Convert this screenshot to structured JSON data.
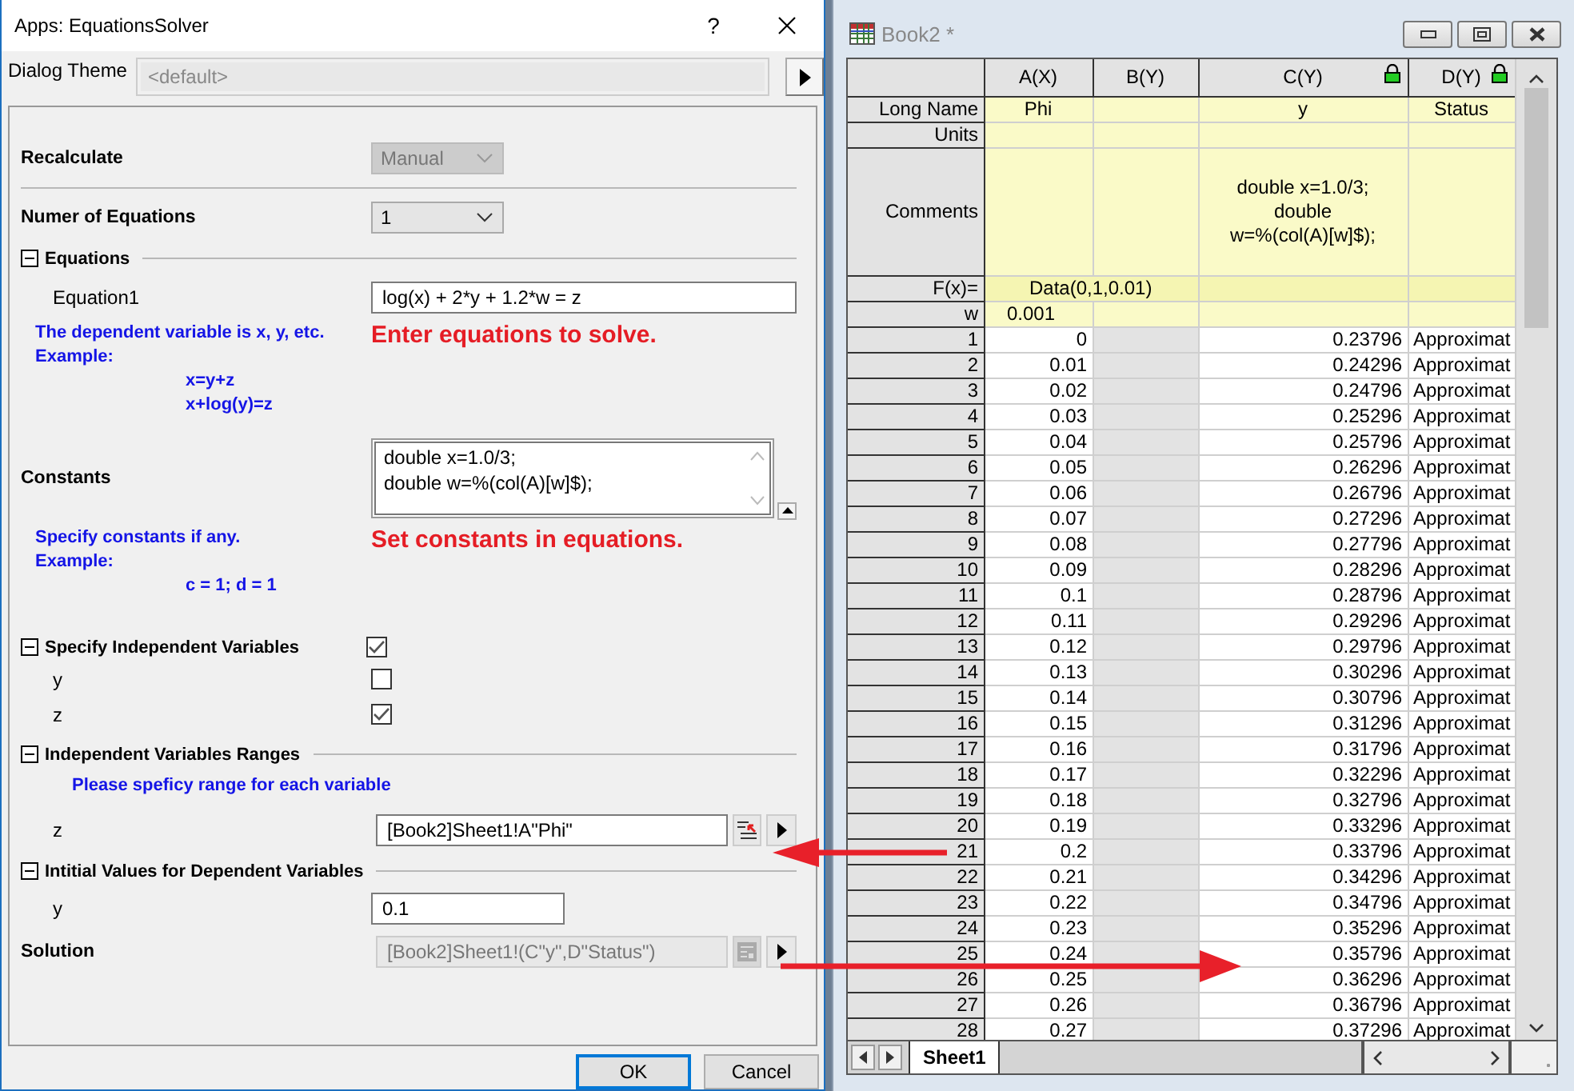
{
  "dialog": {
    "title": "Apps: EquationsSolver",
    "help": "?",
    "theme": {
      "label": "Dialog Theme",
      "value": "<default>"
    },
    "items": [
      {
        "kind": "dropdown",
        "label": "Recalculate",
        "value": "Manual",
        "disabled": true
      },
      {
        "kind": "rule"
      },
      {
        "kind": "dropdown",
        "label": "Numer of Equations",
        "value": "1",
        "disabled": false
      },
      {
        "kind": "section",
        "label": "Equations",
        "expanded": true,
        "children": [
          {
            "kind": "input",
            "label": "Equation1",
            "value": "log(x) + 2*y + 1.2*w = z"
          }
        ]
      },
      {
        "kind": "note",
        "lines": [
          "The dependent variable is x, y, etc.",
          "Example:"
        ],
        "examples": [
          "x=y+z",
          "x+log(y)=z"
        ],
        "hint": "Enter equations to solve."
      },
      {
        "kind": "textarea",
        "label": "Constants",
        "lines": [
          "double x=1.0/3;",
          "double w=%(col(A)[w]$);"
        ]
      },
      {
        "kind": "note",
        "lines": [
          "Specify constants if any.",
          "Example:"
        ],
        "examples": [
          "c = 1; d = 1"
        ],
        "hint": "Set constants in equations."
      },
      {
        "kind": "section",
        "label": "Specify Independent Variables",
        "expanded": true,
        "checked": true,
        "children": [
          {
            "kind": "checkbox",
            "label": "y",
            "checked": false
          },
          {
            "kind": "checkbox",
            "label": "z",
            "checked": true
          }
        ]
      },
      {
        "kind": "section",
        "label": "Independent Variables Ranges",
        "expanded": true,
        "children": [
          {
            "kind": "hint",
            "text": "Please speficy range for each variable"
          },
          {
            "kind": "range",
            "label": "z",
            "value": "[Book2]Sheet1!A\"Phi\"",
            "disabled": false
          }
        ]
      },
      {
        "kind": "section",
        "label": "Intitial Values for Dependent Variables",
        "expanded": true,
        "children": [
          {
            "kind": "number",
            "label": "y",
            "value": "0.1"
          }
        ]
      },
      {
        "kind": "range",
        "label": "Solution",
        "value": "[Book2]Sheet1!(C\"y\",D\"Status\")",
        "disabled": true
      }
    ],
    "buttons": [
      {
        "label": "OK",
        "selected": true
      },
      {
        "label": "Cancel",
        "selected": false
      }
    ]
  },
  "workbook": {
    "title": "Book2 *",
    "columns": [
      {
        "label": "A(X)",
        "locked": false
      },
      {
        "label": "B(Y)",
        "locked": false
      },
      {
        "label": "C(Y)",
        "locked": true
      },
      {
        "label": "D(Y)",
        "locked": true
      }
    ],
    "meta_rows": [
      {
        "kind": "plain",
        "label": "Long Name",
        "cells": [
          "Phi",
          null,
          "y",
          "Status"
        ]
      },
      {
        "kind": "plain",
        "label": "Units",
        "cells": [
          null,
          null,
          null,
          null
        ]
      },
      {
        "kind": "tall",
        "label": "Comments",
        "cells": [
          null,
          null,
          [
            "double x=1.0/3;",
            "double",
            "w=%(col(A)[w]$);"
          ],
          null
        ]
      },
      {
        "kind": "formula",
        "label": "F(x)=",
        "cells": [
          "Data(0,1,0.01)",
          null,
          null
        ]
      },
      {
        "kind": "plain",
        "label": "w",
        "cells": [
          "0.001",
          null,
          null,
          null
        ]
      }
    ],
    "rows": [
      {
        "n": "1",
        "a": "0",
        "c": "0.23796",
        "d": "Approximat"
      },
      {
        "n": "2",
        "a": "0.01",
        "c": "0.24296",
        "d": "Approximat"
      },
      {
        "n": "3",
        "a": "0.02",
        "c": "0.24796",
        "d": "Approximat"
      },
      {
        "n": "4",
        "a": "0.03",
        "c": "0.25296",
        "d": "Approximat"
      },
      {
        "n": "5",
        "a": "0.04",
        "c": "0.25796",
        "d": "Approximat"
      },
      {
        "n": "6",
        "a": "0.05",
        "c": "0.26296",
        "d": "Approximat"
      },
      {
        "n": "7",
        "a": "0.06",
        "c": "0.26796",
        "d": "Approximat"
      },
      {
        "n": "8",
        "a": "0.07",
        "c": "0.27296",
        "d": "Approximat"
      },
      {
        "n": "9",
        "a": "0.08",
        "c": "0.27796",
        "d": "Approximat"
      },
      {
        "n": "10",
        "a": "0.09",
        "c": "0.28296",
        "d": "Approximat"
      },
      {
        "n": "11",
        "a": "0.1",
        "c": "0.28796",
        "d": "Approximat"
      },
      {
        "n": "12",
        "a": "0.11",
        "c": "0.29296",
        "d": "Approximat"
      },
      {
        "n": "13",
        "a": "0.12",
        "c": "0.29796",
        "d": "Approximat"
      },
      {
        "n": "14",
        "a": "0.13",
        "c": "0.30296",
        "d": "Approximat"
      },
      {
        "n": "15",
        "a": "0.14",
        "c": "0.30796",
        "d": "Approximat"
      },
      {
        "n": "16",
        "a": "0.15",
        "c": "0.31296",
        "d": "Approximat"
      },
      {
        "n": "17",
        "a": "0.16",
        "c": "0.31796",
        "d": "Approximat"
      },
      {
        "n": "18",
        "a": "0.17",
        "c": "0.32296",
        "d": "Approximat"
      },
      {
        "n": "19",
        "a": "0.18",
        "c": "0.32796",
        "d": "Approximat"
      },
      {
        "n": "20",
        "a": "0.19",
        "c": "0.33296",
        "d": "Approximat"
      },
      {
        "n": "21",
        "a": "0.2",
        "c": "0.33796",
        "d": "Approximat"
      },
      {
        "n": "22",
        "a": "0.21",
        "c": "0.34296",
        "d": "Approximat"
      },
      {
        "n": "23",
        "a": "0.22",
        "c": "0.34796",
        "d": "Approximat"
      },
      {
        "n": "24",
        "a": "0.23",
        "c": "0.35296",
        "d": "Approximat"
      },
      {
        "n": "25",
        "a": "0.24",
        "c": "0.35796",
        "d": "Approximat"
      },
      {
        "n": "26",
        "a": "0.25",
        "c": "0.36296",
        "d": "Approximat"
      },
      {
        "n": "27",
        "a": "0.26",
        "c": "0.36796",
        "d": "Approximat"
      },
      {
        "n": "28",
        "a": "0.27",
        "c": "0.37296",
        "d": "Approximat"
      }
    ],
    "sheets": [
      {
        "label": "Sheet1",
        "selected": true
      }
    ]
  }
}
